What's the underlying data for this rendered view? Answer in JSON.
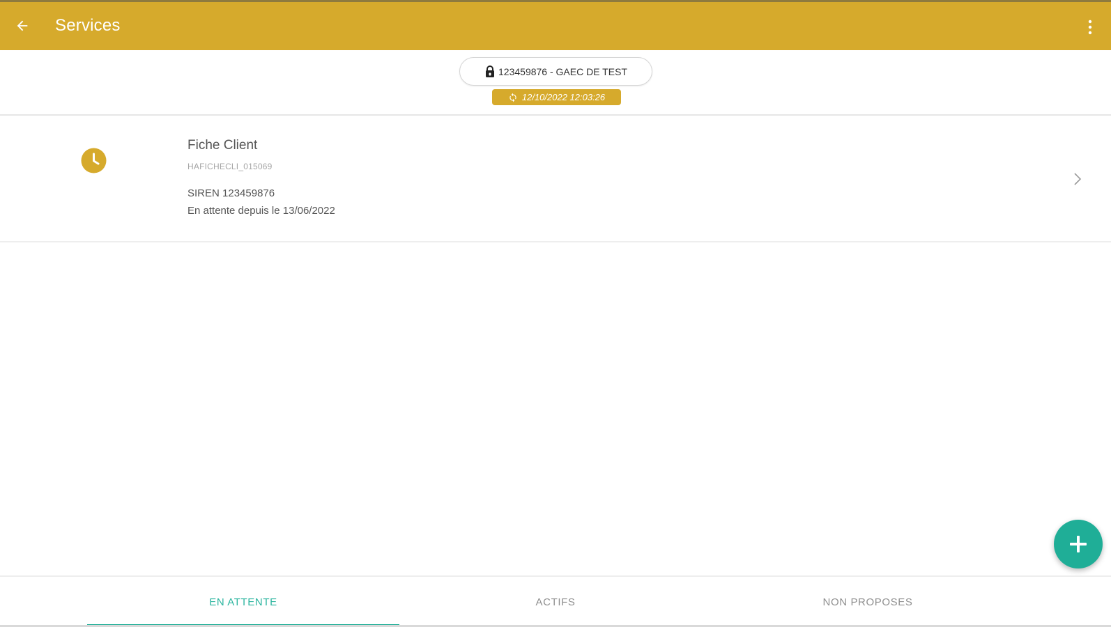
{
  "header": {
    "title": "Services",
    "back_icon": "arrow-left-icon",
    "menu_icon": "more-vertical-icon",
    "background_color": "#D6AA2C"
  },
  "context": {
    "client_label": "123459876 - GAEC DE TEST",
    "client_icon": "lock-icon",
    "sync_label": "12/10/2022 12:03:26",
    "sync_icon": "sync-icon"
  },
  "list": {
    "items": [
      {
        "title": "Fiche Client",
        "code": "HAFICHECLI_015069",
        "siren": "SIREN 123459876",
        "waiting": "En attente depuis le 13/06/2022",
        "status_icon": "clock-icon",
        "status_color": "#D6AA2C"
      }
    ]
  },
  "fab": {
    "icon": "plus-icon",
    "color": "#1FAE97"
  },
  "tabs": {
    "items": [
      {
        "label": "EN ATTENTE",
        "active": true
      },
      {
        "label": "ACTIFS",
        "active": false
      },
      {
        "label": "NON PROPOSES",
        "active": false
      }
    ],
    "active_color": "#2BB59F"
  }
}
